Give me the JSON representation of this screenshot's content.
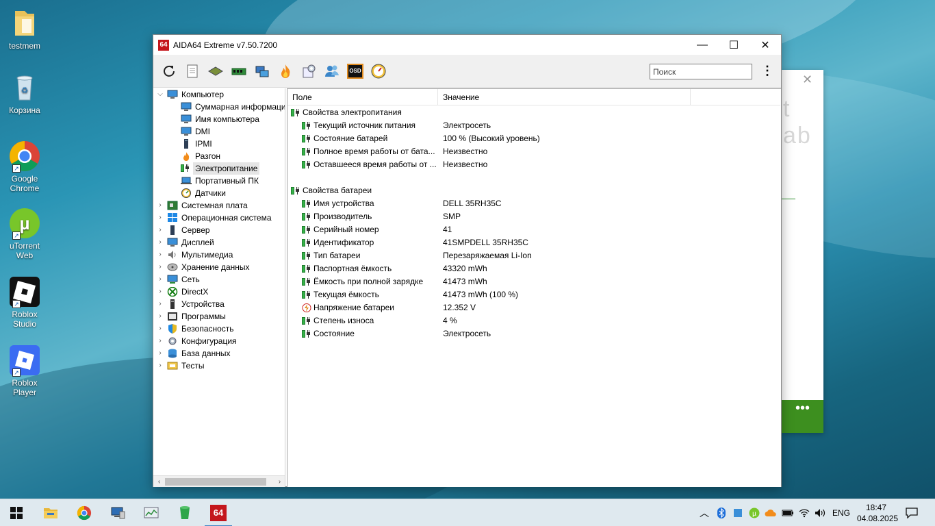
{
  "desktop": {
    "icons": [
      {
        "label": "testmem"
      },
      {
        "label": "Корзина"
      },
      {
        "label": "Google Chrome"
      },
      {
        "label": "uTorrent Web"
      },
      {
        "label": "Roblox Studio"
      },
      {
        "label": "Roblox Player"
      }
    ]
  },
  "background_window": {
    "partial_text": "t ab",
    "menu_dots": "•••"
  },
  "window": {
    "title": "AIDA64 Extreme v7.50.7200",
    "logo_text": "64",
    "controls": {
      "minimize": "—",
      "maximize": "☐",
      "close": "✕"
    }
  },
  "toolbar": {
    "search_placeholder": "Поиск",
    "osd_label": "OSD",
    "more": "⋮"
  },
  "tree": {
    "items": [
      {
        "label": "Компьютер",
        "expander": "⌵"
      },
      {
        "label": "Суммарная информация"
      },
      {
        "label": "Имя компьютера"
      },
      {
        "label": "DMI"
      },
      {
        "label": "IPMI"
      },
      {
        "label": "Разгон"
      },
      {
        "label": "Электропитание"
      },
      {
        "label": "Портативный ПК"
      },
      {
        "label": "Датчики"
      },
      {
        "label": "Системная плата",
        "expander": "›"
      },
      {
        "label": "Операционная система",
        "expander": "›"
      },
      {
        "label": "Сервер",
        "expander": "›"
      },
      {
        "label": "Дисплей",
        "expander": "›"
      },
      {
        "label": "Мультимедиа",
        "expander": "›"
      },
      {
        "label": "Хранение данных",
        "expander": "›"
      },
      {
        "label": "Сеть",
        "expander": "›"
      },
      {
        "label": "DirectX",
        "expander": "›"
      },
      {
        "label": "Устройства",
        "expander": "›"
      },
      {
        "label": "Программы",
        "expander": "›"
      },
      {
        "label": "Безопасность",
        "expander": "›"
      },
      {
        "label": "Конфигурация",
        "expander": "›"
      },
      {
        "label": "База данных",
        "expander": "›"
      },
      {
        "label": "Тесты",
        "expander": "›"
      }
    ],
    "scroll_left": "‹",
    "scroll_right": "›"
  },
  "table": {
    "columns": {
      "field": "Поле",
      "value": "Значение"
    },
    "group1": {
      "title": "Свойства электропитания",
      "rows": [
        {
          "field": "Текущий источник питания",
          "value": "Электросеть"
        },
        {
          "field": "Состояние батарей",
          "value": "100 % (Высокий уровень)"
        },
        {
          "field": "Полное время работы от бата...",
          "value": "Неизвестно"
        },
        {
          "field": "Оставшееся время работы от ...",
          "value": "Неизвестно"
        }
      ]
    },
    "group2": {
      "title": "Свойства батареи",
      "rows": [
        {
          "field": "Имя устройства",
          "value": "DELL 35RH35C"
        },
        {
          "field": "Производитель",
          "value": "SMP"
        },
        {
          "field": "Серийный номер",
          "value": "41"
        },
        {
          "field": "Идентификатор",
          "value": "41SMPDELL 35RH35C"
        },
        {
          "field": "Тип батареи",
          "value": "Перезаряжаемая Li-Ion"
        },
        {
          "field": "Паспортная ёмкость",
          "value": "43320 mWh"
        },
        {
          "field": "Ёмкость при полной зарядке",
          "value": "41473 mWh"
        },
        {
          "field": "Текущая ёмкость",
          "value": "41473 mWh  (100 %)"
        },
        {
          "field": "Напряжение батареи",
          "value": "12.352 V"
        },
        {
          "field": "Степень износа",
          "value": "4 %"
        },
        {
          "field": "Состояние",
          "value": "Электросеть"
        }
      ]
    }
  },
  "taskbar": {
    "aida_label": "64",
    "language": "ENG",
    "time": "18:47",
    "date": "04.08.2025"
  },
  "colors": {
    "battery_green": "#37b34a",
    "aida_red": "#c4161c",
    "selection": "#e5e5e5"
  }
}
